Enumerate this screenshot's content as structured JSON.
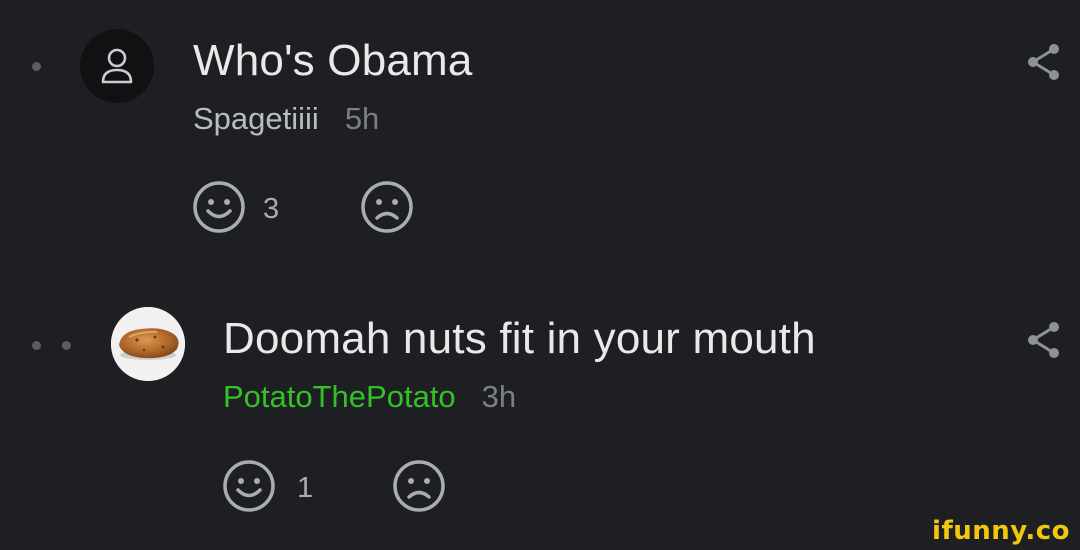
{
  "comments": [
    {
      "text": "Who's Obama",
      "username": "Spagetiiii",
      "time": "5h",
      "like_count": "3",
      "avatar": "default-user-icon"
    },
    {
      "text": "Doomah nuts fit in your mouth",
      "username": "PotatoThePotato",
      "time": "3h",
      "like_count": "1",
      "avatar": "potato-avatar"
    }
  ],
  "colors": {
    "background": "#1e1f23",
    "username_highlight": "#34c027",
    "watermark": "#f2c80f"
  },
  "icons": [
    "user-icon",
    "smile-icon",
    "frown-icon",
    "share-icon"
  ],
  "watermark": "ifunny.co"
}
